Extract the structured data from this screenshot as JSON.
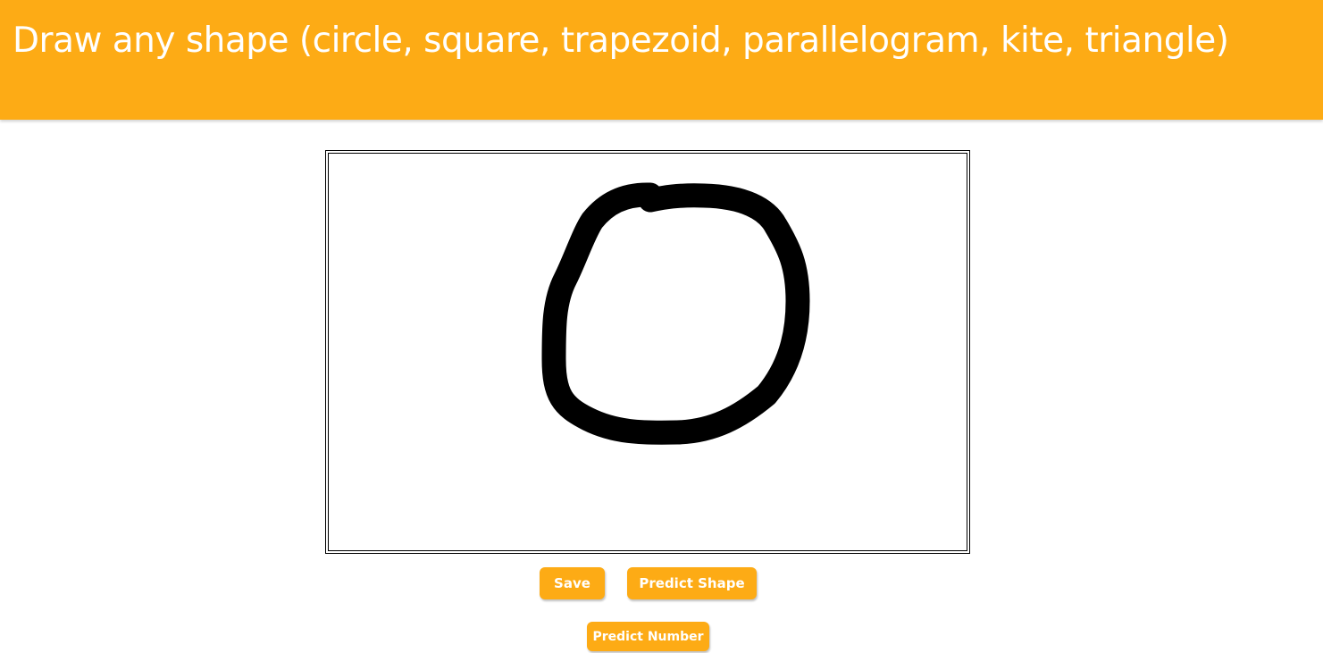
{
  "header": {
    "title": "Draw any shape (circle, square, trapezoid, parallelogram, kite, triangle)"
  },
  "canvas": {
    "drawn_shape": "circle"
  },
  "buttons": {
    "save_label": "Save",
    "predict_shape_label": "Predict Shape",
    "predict_number_label": "Predict Number"
  },
  "colors": {
    "accent": "#fdab15",
    "text_on_accent": "#ffffff",
    "ink": "#000000"
  }
}
